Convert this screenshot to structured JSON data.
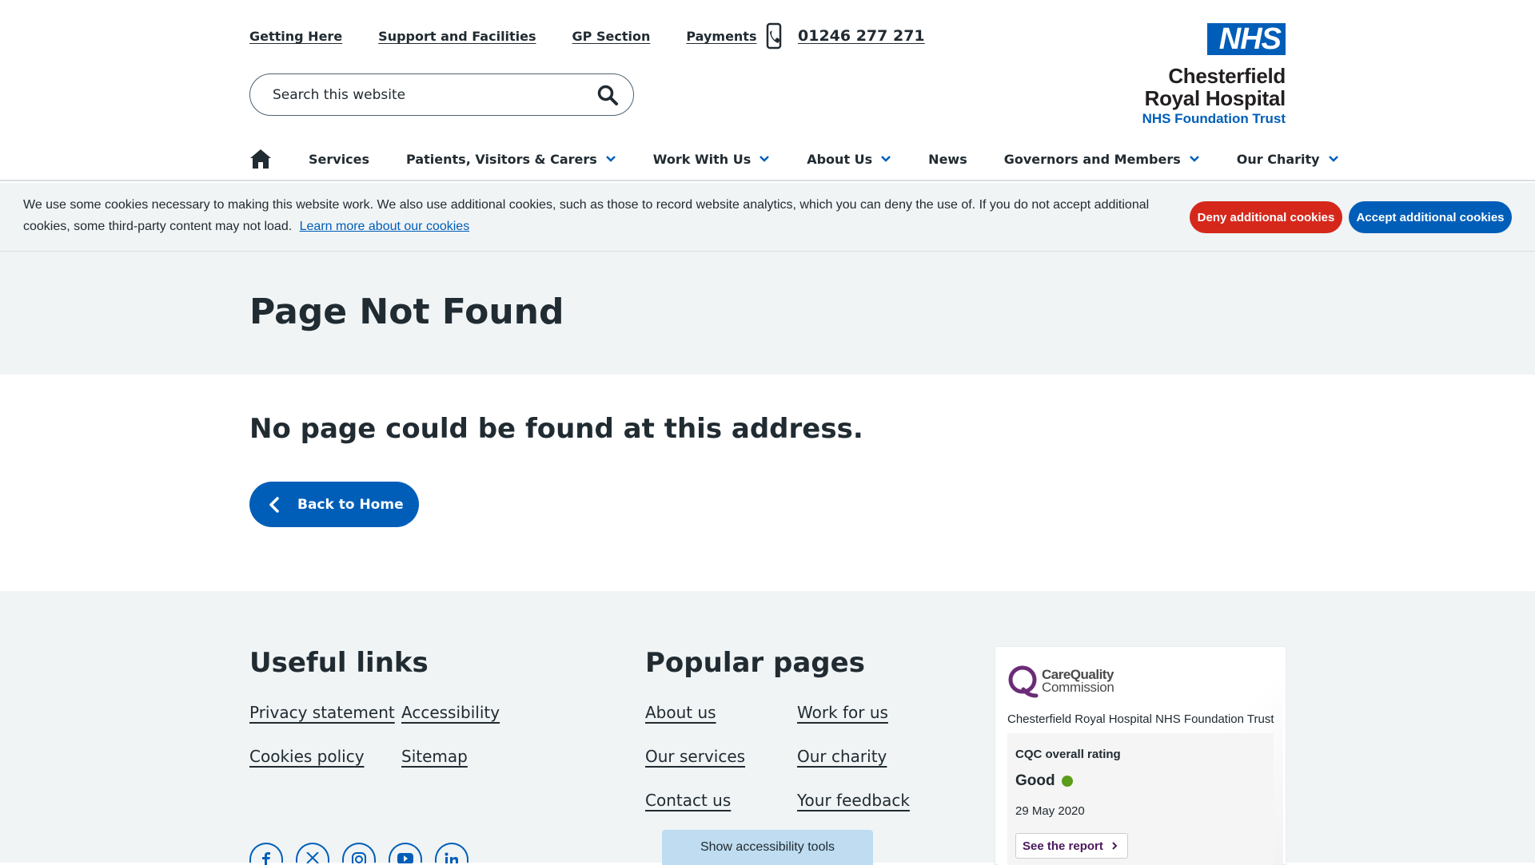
{
  "header": {
    "top_links": [
      "Getting Here",
      "Support and Facilities",
      "GP Section",
      "Payments"
    ],
    "phone": "01246 277 271",
    "search_placeholder": "Search this website",
    "logo": {
      "badge": "NHS",
      "line1": "Chesterfield",
      "line2": "Royal Hospital",
      "line3": "NHS Foundation Trust"
    },
    "nav": [
      "Services",
      "Patients, Visitors & Carers",
      "Work With Us",
      "About Us",
      "News",
      "Governors and Members",
      "Our Charity"
    ]
  },
  "cookie": {
    "message": "We use some cookies necessary to making this website work. We also use additional cookies, such as those to record website analytics, which you can deny the use of. If you do not accept additional cookies, some third-party content may not load.",
    "learn_more": "Learn more about our cookies",
    "deny_label": "Deny additional cookies",
    "accept_label": "Accept additional cookies"
  },
  "page": {
    "title": "Page Not Found",
    "message": "No page could be found at this address.",
    "back_label": "Back to Home"
  },
  "footer": {
    "useful_title": "Useful links",
    "useful_links": [
      "Privacy statement",
      "Accessibility",
      "Cookies policy",
      "Sitemap"
    ],
    "popular_title": "Popular pages",
    "popular_links": [
      "About us",
      "Work for us",
      "Our services",
      "Our charity",
      "Contact us",
      "Your feedback"
    ],
    "social_icons": [
      "facebook-icon",
      "x-icon",
      "instagram-icon",
      "youtube-icon",
      "linkedin-icon"
    ],
    "accessibility_tools": "Show accessibility tools"
  },
  "cqc": {
    "brand_line1": "CareQuality",
    "brand_line2": "Commission",
    "trust_name": "Chesterfield Royal Hospital NHS Foundation Trust",
    "rating_label": "CQC overall rating",
    "rating": "Good",
    "date": "29 May 2020",
    "report_label": "See the report"
  },
  "colors": {
    "nhs_blue": "#005eb8",
    "deny_red": "#d5281b",
    "good_green": "#5b9c1b",
    "cqc_purple": "#4a1a5c"
  }
}
